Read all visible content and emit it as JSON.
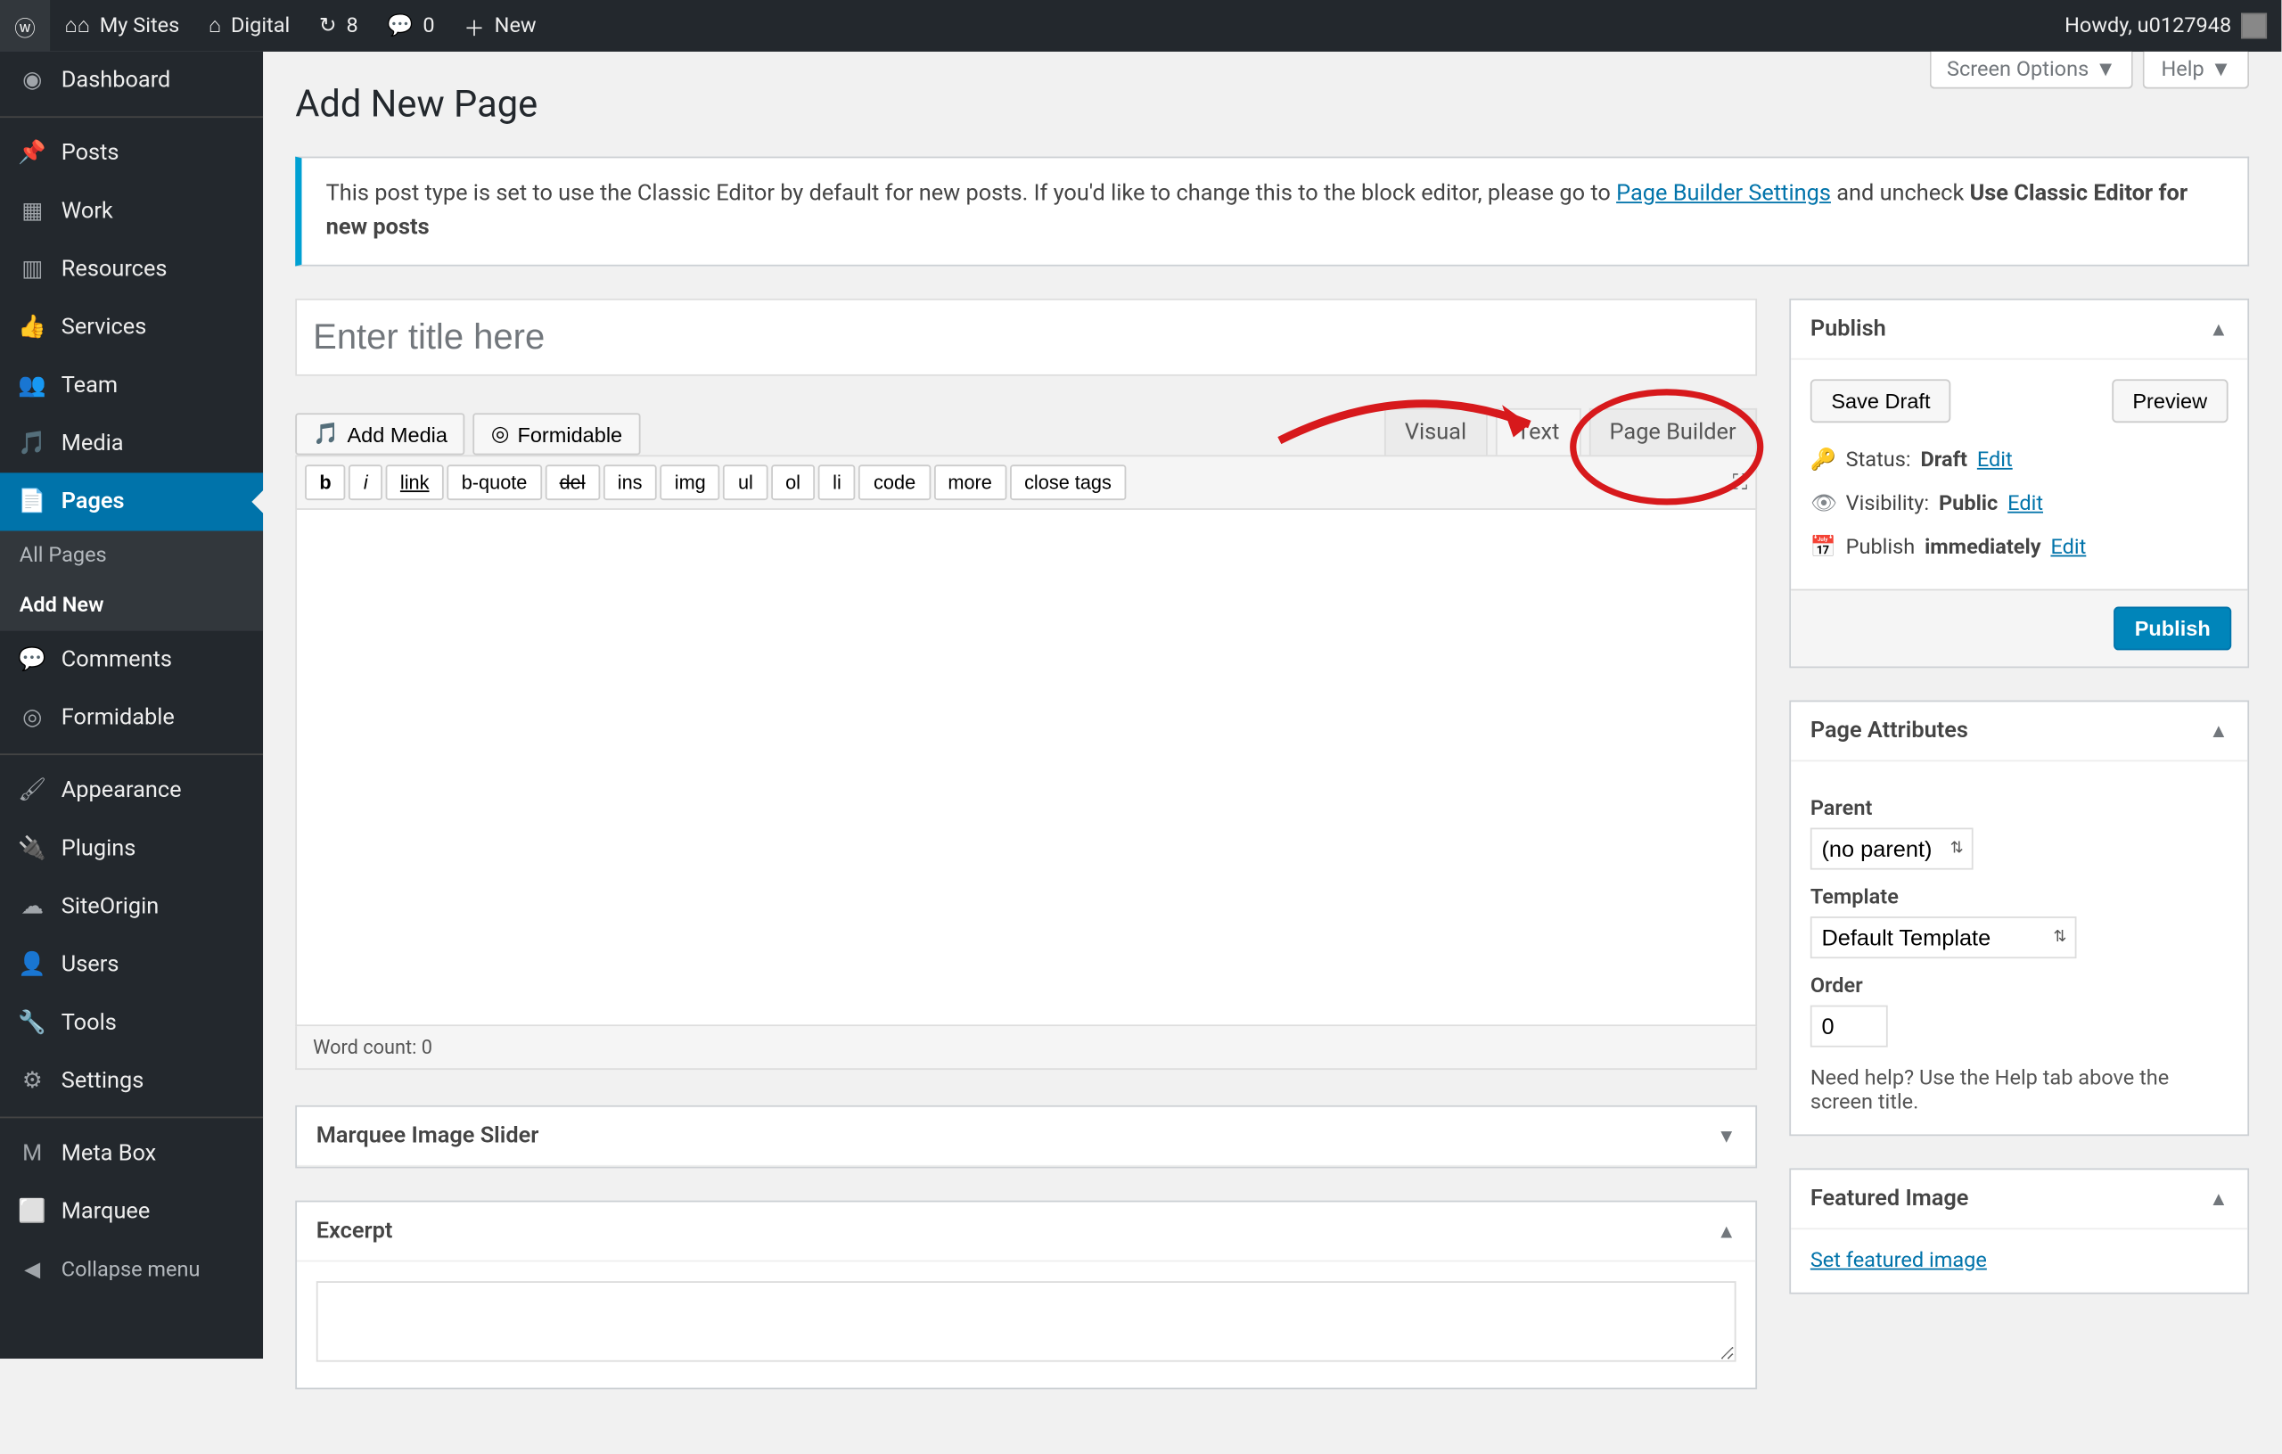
{
  "toolbar": {
    "my_sites": "My Sites",
    "site_name": "Digital",
    "updates": "8",
    "comments": "0",
    "new": "New",
    "howdy": "Howdy, u0127948"
  },
  "sidebar": {
    "items": [
      {
        "label": "Dashboard",
        "icon": "dashboard"
      },
      {
        "label": "Posts",
        "icon": "pin"
      },
      {
        "label": "Work",
        "icon": "work"
      },
      {
        "label": "Resources",
        "icon": "resources"
      },
      {
        "label": "Services",
        "icon": "thumb"
      },
      {
        "label": "Team",
        "icon": "team"
      },
      {
        "label": "Media",
        "icon": "media"
      },
      {
        "label": "Pages",
        "icon": "pages"
      },
      {
        "label": "Comments",
        "icon": "comments"
      },
      {
        "label": "Formidable",
        "icon": "formidable"
      },
      {
        "label": "Appearance",
        "icon": "appearance"
      },
      {
        "label": "Plugins",
        "icon": "plugins"
      },
      {
        "label": "SiteOrigin",
        "icon": "siteorigin"
      },
      {
        "label": "Users",
        "icon": "users"
      },
      {
        "label": "Tools",
        "icon": "tools"
      },
      {
        "label": "Settings",
        "icon": "settings"
      },
      {
        "label": "Meta Box",
        "icon": "metabox"
      },
      {
        "label": "Marquee",
        "icon": "marquee"
      }
    ],
    "submenu": {
      "all_pages": "All Pages",
      "add_new": "Add New"
    },
    "collapse": "Collapse menu"
  },
  "screen_meta": {
    "options": "Screen Options",
    "help": "Help"
  },
  "page_title": "Add New Page",
  "notice": {
    "text1": "This post type is set to use the Classic Editor by default for new posts. If you'd like to change this to the block editor, please go to ",
    "link": "Page Builder Settings",
    "text2": " and uncheck ",
    "bold": "Use Classic Editor for new posts"
  },
  "title_placeholder": "Enter title here",
  "media": {
    "add_media": "Add Media",
    "formidable": "Formidable"
  },
  "editor_tabs": [
    "Visual",
    "Text",
    "Page Builder"
  ],
  "quicktags": [
    "b",
    "i",
    "link",
    "b-quote",
    "del",
    "ins",
    "img",
    "ul",
    "ol",
    "li",
    "code",
    "more",
    "close tags"
  ],
  "word_count_label": "Word count: ",
  "word_count": "0",
  "publish": {
    "title": "Publish",
    "save_draft": "Save Draft",
    "preview": "Preview",
    "status_label": "Status:",
    "status_value": "Draft",
    "status_edit": "Edit",
    "vis_label": "Visibility:",
    "vis_value": "Public",
    "vis_edit": "Edit",
    "sched_label": "Publish",
    "sched_value": "immediately",
    "sched_edit": "Edit",
    "publish_btn": "Publish"
  },
  "attrs": {
    "title": "Page Attributes",
    "parent_label": "Parent",
    "parent_value": "(no parent)",
    "template_label": "Template",
    "template_value": "Default Template",
    "order_label": "Order",
    "order_value": "0",
    "help": "Need help? Use the Help tab above the screen title."
  },
  "featured": {
    "title": "Featured Image",
    "link": "Set featured image"
  },
  "marquee_box": "Marquee Image Slider",
  "excerpt_box": "Excerpt"
}
